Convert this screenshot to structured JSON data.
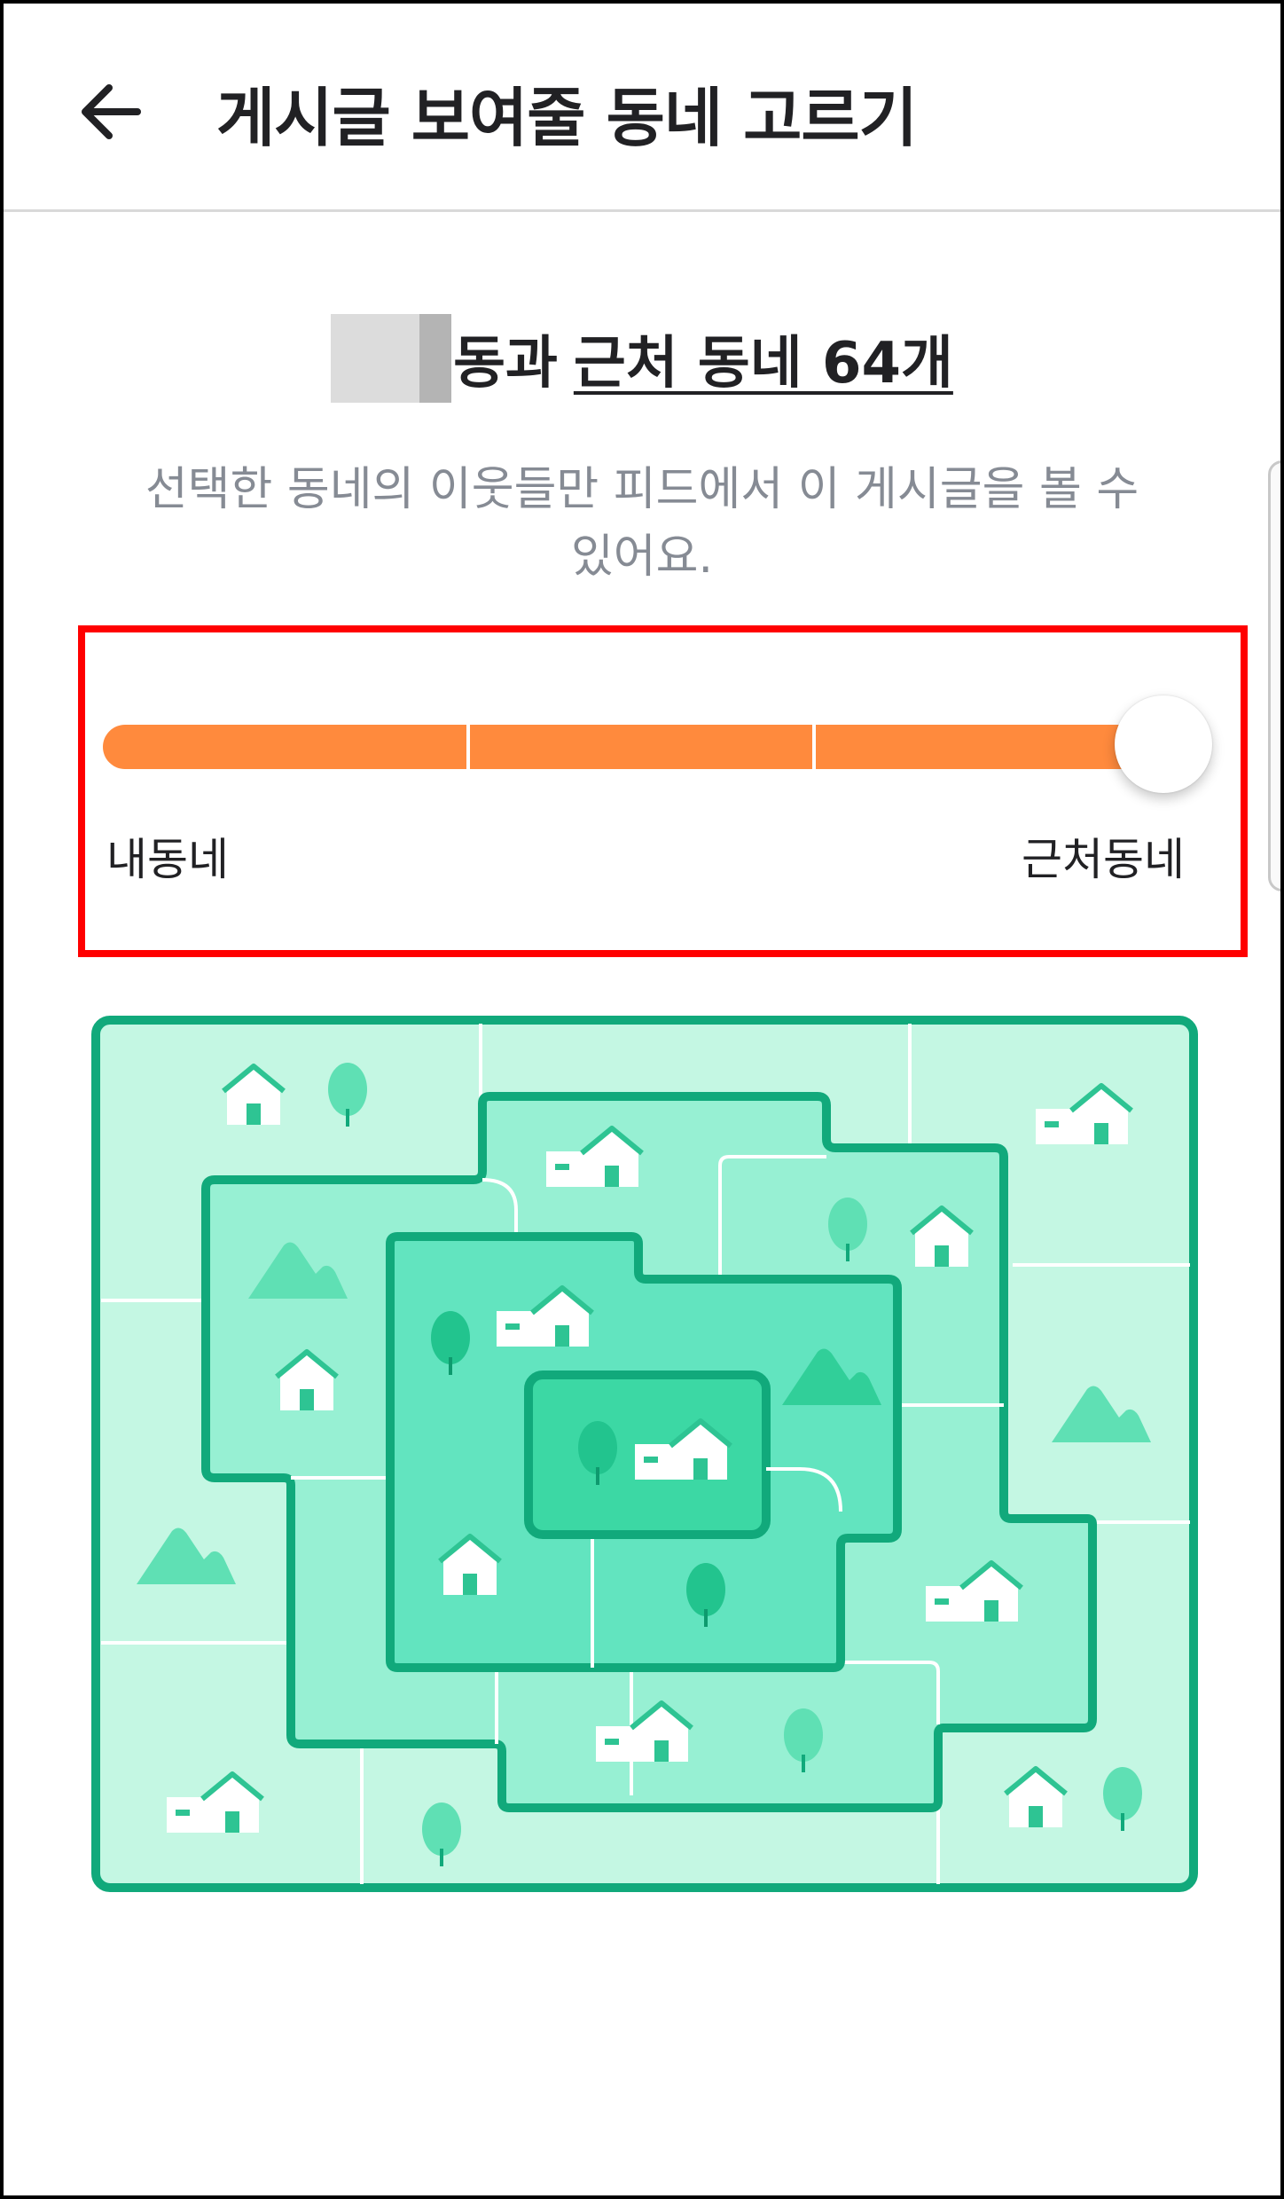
{
  "header": {
    "back_icon": "arrow-left-icon",
    "title": "게시글 보여줄 동네 고르기"
  },
  "summary": {
    "neighborhood_suffix": "동과",
    "nearby_count_text": "근처 동네 64개"
  },
  "description": "선택한 동네의 이웃들만 피드에서 이 게시글을 볼 수 있어요.",
  "range_slider": {
    "min_label": "내동네",
    "max_label": "근처동네",
    "steps": 4,
    "selected_step": 4,
    "selected_fraction": 1.0
  },
  "colors": {
    "accent_orange": "#ff8a3d",
    "highlight_frame": "#ff0000",
    "map_border_green": "#11a97b",
    "map_light": "#c4f7e3",
    "map_medium": "#97f0d3",
    "map_strong": "#62e4bf",
    "map_center": "#3cd8a4"
  },
  "illustration": {
    "icon": "neighborhood-map-illustration"
  }
}
